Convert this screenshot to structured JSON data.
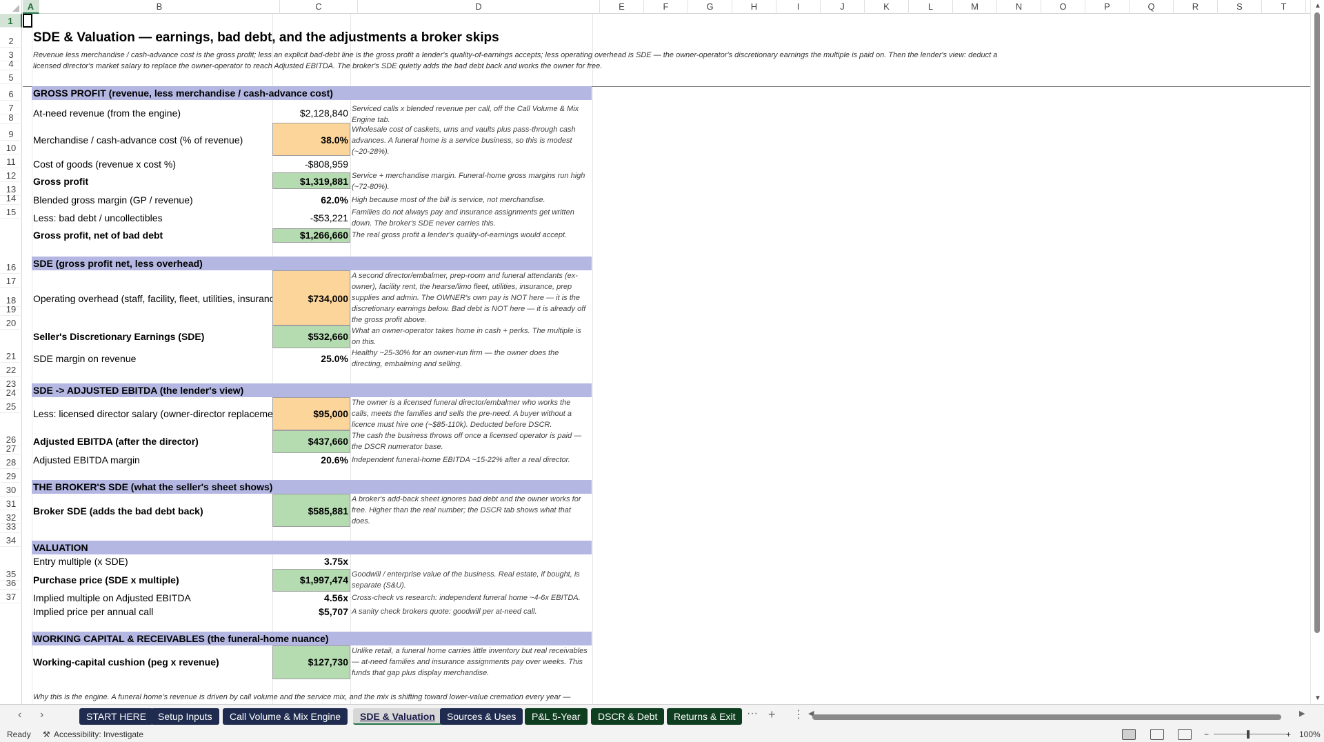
{
  "columns": [
    "A",
    "B",
    "C",
    "D",
    "E",
    "F",
    "G",
    "H",
    "I",
    "J",
    "K",
    "L",
    "M",
    "N",
    "O",
    "P",
    "Q",
    "R",
    "S",
    "T"
  ],
  "selected_cell": "A1",
  "title": "SDE & Valuation — earnings, bad debt, and the adjustments a broker skips",
  "subtitle": "Revenue less merchandise / cash-advance cost is the gross profit; less an explicit bad-debt line is the gross profit a lender's quality-of-earnings accepts; less operating overhead is SDE — the owner-operator's discretionary earnings the multiple is paid on. Then the lender's view: deduct a licensed director's market salary to replace the owner-operator to reach Adjusted EBITDA. The broker's SDE quietly adds the bad debt back and works the owner for free.",
  "sections": {
    "gross_profit": "GROSS PROFIT  (revenue, less merchandise / cash-advance cost)",
    "sde": "SDE  (gross profit net, less overhead)",
    "ebitda": "SDE -> ADJUSTED EBITDA  (the lender's view)",
    "broker": "THE BROKER'S SDE  (what the seller's sheet shows)",
    "valuation": "VALUATION",
    "wc": "WORKING CAPITAL & RECEIVABLES  (the funeral-home nuance)"
  },
  "rows": {
    "r6": {
      "label": "At-need revenue (from the engine)",
      "value": "$2,128,840",
      "note": "Serviced calls x blended revenue per call, off the Call Volume & Mix Engine tab."
    },
    "r7": {
      "label": "Merchandise / cash-advance cost (% of revenue)",
      "value": "38.0%",
      "note": "Wholesale cost of caskets, urns and vaults plus pass-through cash advances. A funeral home is a service business, so this is modest (~20-28%)."
    },
    "r8": {
      "label": "Cost of goods (revenue x cost %)",
      "value": "-$808,959",
      "note": ""
    },
    "r9": {
      "label": "Gross profit",
      "value": "$1,319,881",
      "note": "Service + merchandise margin. Funeral-home gross margins run high (~72-80%)."
    },
    "r10": {
      "label": "Blended gross margin (GP / revenue)",
      "value": "62.0%",
      "note": "High because most of the bill is service, not merchandise."
    },
    "r11": {
      "label": "Less: bad debt / uncollectibles",
      "value": "-$53,221",
      "note": "Families do not always pay and insurance assignments get written down. The broker's SDE never carries this."
    },
    "r12": {
      "label": "Gross profit, net of bad debt",
      "value": "$1,266,660",
      "note": "The real gross profit a lender's quality-of-earnings would accept."
    },
    "r15": {
      "label": "Operating overhead (staff, facility, fleet, utilities, insurance, admin)",
      "value": "$734,000",
      "note": "A second director/embalmer, prep-room and funeral attendants (ex-owner), facility rent, the hearse/limo fleet, utilities, insurance, prep supplies and admin. The OWNER's own pay is NOT here — it is the discretionary earnings below. Bad debt is NOT here — it is already off the gross profit above."
    },
    "r16": {
      "label": "Seller's Discretionary Earnings (SDE)",
      "value": "$532,660",
      "note": "What an owner-operator takes home in cash + perks. The multiple is on this."
    },
    "r17": {
      "label": "SDE margin on revenue",
      "value": "25.0%",
      "note": "Healthy ~25-30% for an owner-run firm — the owner does the directing, embalming and selling."
    },
    "r20": {
      "label": "Less: licensed director salary (owner-director replacement)",
      "value": "$95,000",
      "note": "The owner is a licensed funeral director/embalmer who works the calls, meets the families and sells the pre-need. A buyer without a licence must hire one (~$85-110k). Deducted before DSCR."
    },
    "r21": {
      "label": "Adjusted EBITDA (after the director)",
      "value": "$437,660",
      "note": "The cash the business throws off once a licensed operator is paid — the DSCR numerator base."
    },
    "r22": {
      "label": "Adjusted EBITDA margin",
      "value": "20.6%",
      "note": "Independent funeral-home EBITDA ~15-22% after a real director."
    },
    "r25": {
      "label": "Broker SDE (adds the bad debt back)",
      "value": "$585,881",
      "note": "A broker's add-back sheet ignores bad debt and the owner works for free. Higher than the real number; the DSCR tab shows what that does."
    },
    "r28": {
      "label": "Entry multiple (x SDE)",
      "value": "3.75x",
      "note": ""
    },
    "r29": {
      "label": "Purchase price (SDE x multiple)",
      "value": "$1,997,474",
      "note": "Goodwill / enterprise value of the business. Real estate, if bought, is separate (S&U)."
    },
    "r30": {
      "label": "Implied multiple on Adjusted EBITDA",
      "value": "4.56x",
      "note": "Cross-check vs research: independent funeral home ~4-6x EBITDA."
    },
    "r31": {
      "label": "Implied price per annual call",
      "value": "$5,707",
      "note": "A sanity check brokers quote: goodwill per at-need call."
    },
    "r34": {
      "label": "Working-capital cushion (peg x revenue)",
      "value": "$127,730",
      "note": "Unlike retail, a funeral home carries little inventory but real receivables — at-need families and insurance assignments pay over weeks. This funds that gap plus display merchandise."
    }
  },
  "footer_text": "Why this is the engine. A funeral home's revenue is driven by call volume and the service mix, and the mix is shifting toward lower-value cremation every year —",
  "tabs": [
    "START HERE",
    "Setup Inputs",
    "Call Volume & Mix Engine",
    "SDE & Valuation",
    "Sources & Uses",
    "P&L 5-Year",
    "DSCR & Debt",
    "Returns & Exit"
  ],
  "active_tab": "SDE & Valuation",
  "tab_colors": [
    "#1f2b4f",
    "#1f2b4f",
    "#1f2b4f",
    "#d7d7d7",
    "#1f2b4f",
    "#0f3d1f",
    "#0f3d1f",
    "#0f3d1f"
  ],
  "status": {
    "ready": "Ready",
    "accessibility": "Accessibility: Investigate",
    "zoom": "100%"
  }
}
